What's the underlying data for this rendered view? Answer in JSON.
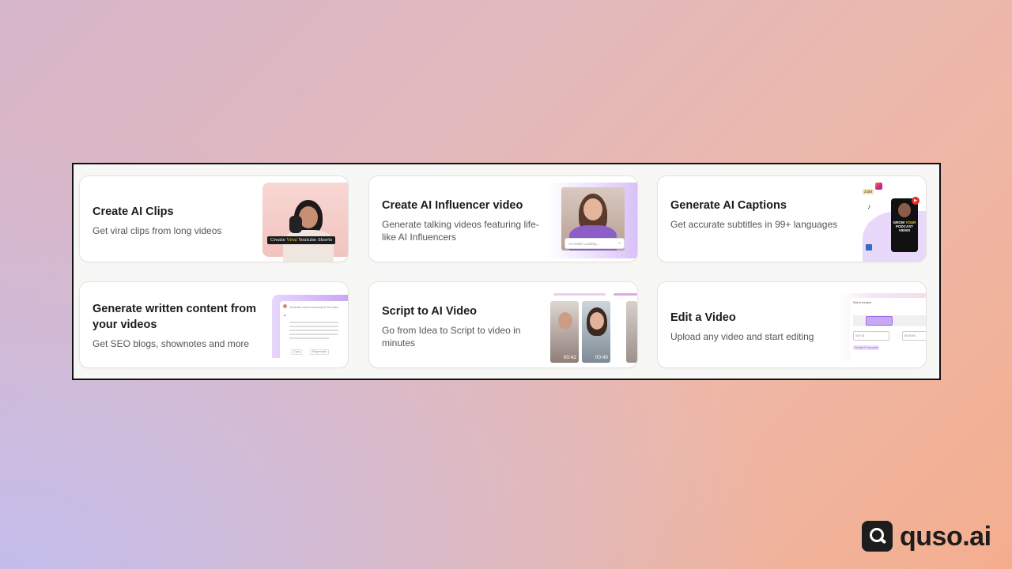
{
  "cards": [
    {
      "title": "Create AI Clips",
      "description": "Get viral clips from long videos",
      "visual": {
        "caption_prefix": "Create",
        "caption_highlight": "Viral",
        "caption_suffix": "Youtube Shorts"
      }
    },
    {
      "title": "Create AI Influencer video",
      "description": "Generate talking videos featuring life-like AI Influencers",
      "visual": {
        "input_placeholder": "AI Avatar Loading..."
      }
    },
    {
      "title": "Generate AI Captions",
      "description": "Get accurate subtitles in 99+ languages",
      "visual": {
        "badge": "3.5M",
        "caption_line1": "GROW",
        "caption_highlight": "YOUR",
        "caption_line2": "PODCAST VIEWS"
      }
    },
    {
      "title": "Generate written content from your videos",
      "description": "Get SEO blogs, shownotes and more",
      "visual": {
        "prompt": "Generate a short summary for the video",
        "copy_label": "Copy",
        "regenerate_label": "Regenerate"
      }
    },
    {
      "title": "Script to AI Video",
      "description": "Go from Idea to Script to video in minutes",
      "visual": {
        "times": [
          "00:42",
          "00:40"
        ]
      }
    },
    {
      "title": "Edit a Video",
      "description": "Upload any video and start editing",
      "visual": {
        "heading": "Select duration",
        "start": "0:07:31",
        "end": "00:20:00",
        "tag": "Fit into 01 seconds"
      }
    }
  ],
  "logo": {
    "text": "quso.ai"
  }
}
